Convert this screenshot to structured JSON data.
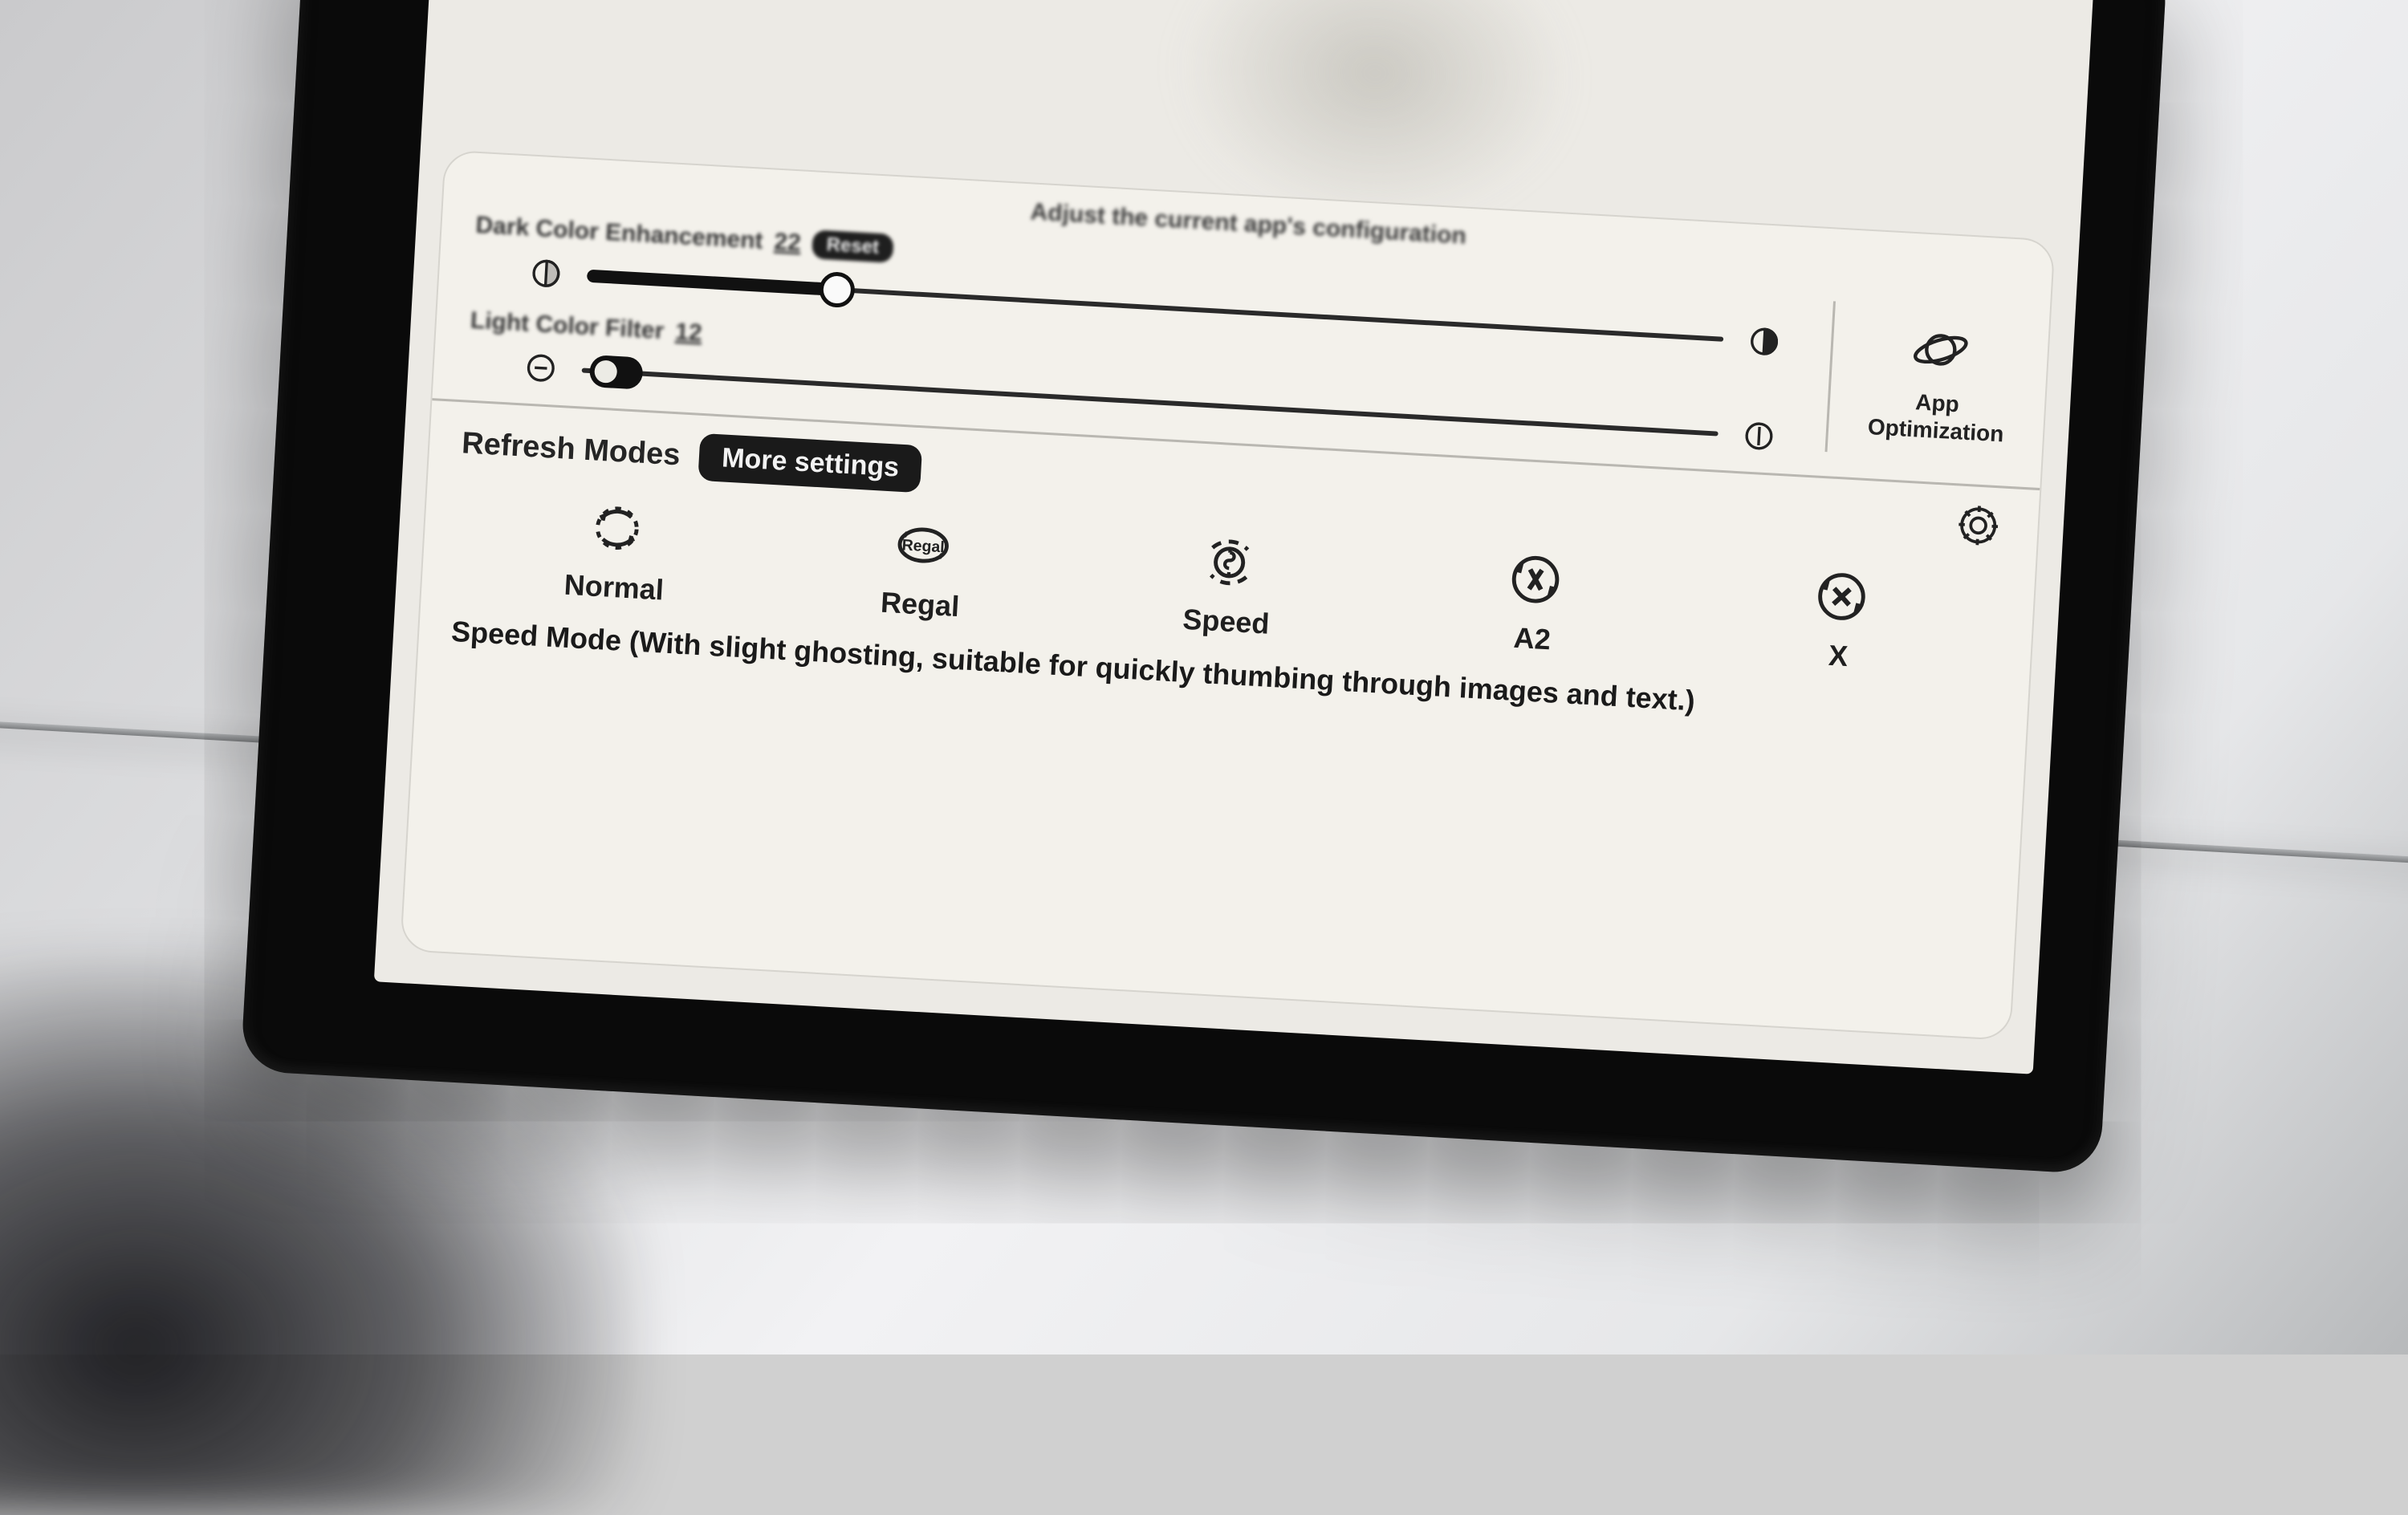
{
  "panel": {
    "title": "Adjust the current app's configuration",
    "dark_enhancement": {
      "label": "Dark Color Enhancement",
      "value": "22",
      "reset": "Reset",
      "percent": 22
    },
    "light_filter": {
      "label": "Light Color Filter",
      "value": "12",
      "percent": 3,
      "toggle_on": false
    },
    "app_opt": {
      "label": "App\nOptimization"
    }
  },
  "modes": {
    "header": "Refresh Modes",
    "more": "More settings",
    "items": [
      {
        "id": "normal",
        "label": "Normal"
      },
      {
        "id": "regal",
        "label": "Regal"
      },
      {
        "id": "speed",
        "label": "Speed"
      },
      {
        "id": "a2",
        "label": "A2"
      },
      {
        "id": "x",
        "label": "X"
      }
    ],
    "description": "Speed Mode (With slight ghosting, suitable for quickly thumbing through images and text.)"
  }
}
